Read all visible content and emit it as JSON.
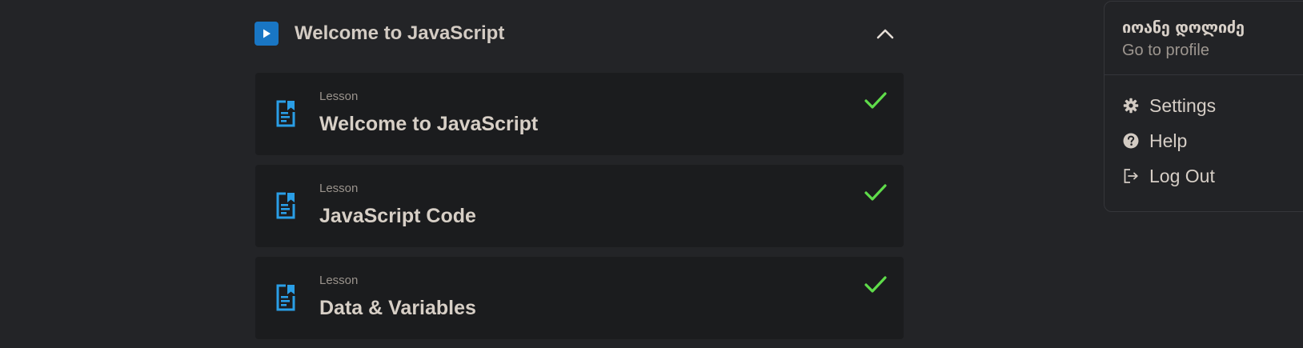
{
  "section": {
    "title": "Welcome to JavaScript",
    "play_icon": "play-icon",
    "collapse_icon": "chevron-up-icon",
    "accent_color": "#1976c4"
  },
  "lessons": [
    {
      "kind": "Lesson",
      "title": "Welcome to JavaScript",
      "completed": true,
      "icon": "lesson-document-icon"
    },
    {
      "kind": "Lesson",
      "title": "JavaScript Code",
      "completed": true,
      "icon": "lesson-document-icon"
    },
    {
      "kind": "Lesson",
      "title": "Data & Variables",
      "completed": true,
      "icon": "lesson-document-icon"
    }
  ],
  "colors": {
    "lesson_icon": "#2a9ee6",
    "check": "#5fdc4a",
    "background": "#232427",
    "card": "#1b1c1e"
  },
  "profile_menu": {
    "username": "იოანე დოლიძე",
    "profile_link": "Go to profile",
    "items": [
      {
        "label": "Settings",
        "icon": "gear-icon"
      },
      {
        "label": "Help",
        "icon": "help-circle-icon"
      },
      {
        "label": "Log Out",
        "icon": "logout-icon"
      }
    ]
  }
}
